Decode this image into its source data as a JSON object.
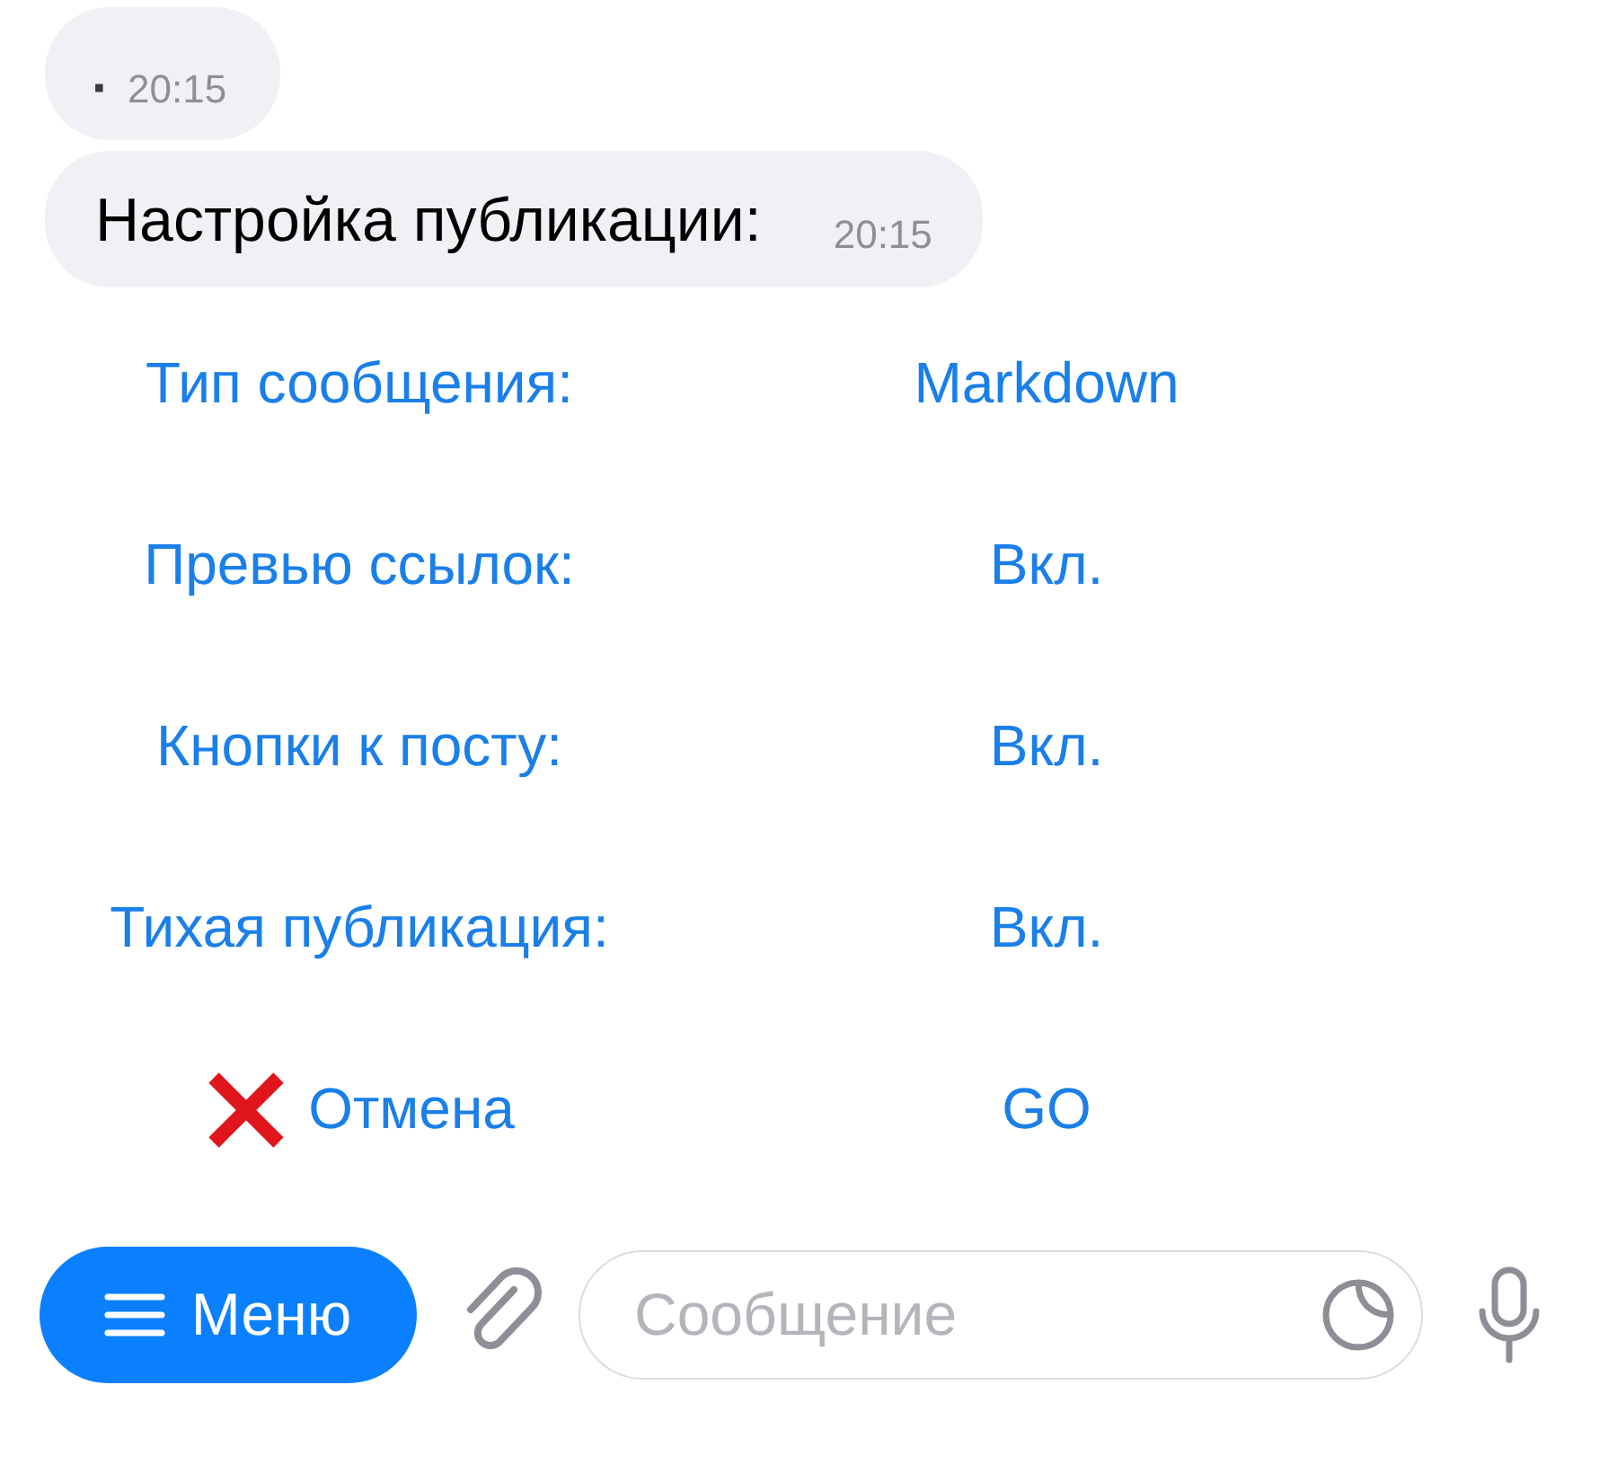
{
  "messages": [
    {
      "kind": "time_only",
      "marker": "·",
      "time": "20:15"
    },
    {
      "kind": "text",
      "text": "Настройка публикации:",
      "time": "20:15"
    }
  ],
  "keyboard": [
    [
      {
        "kind": "plain",
        "label": "Тип сообщения:"
      },
      {
        "kind": "plain",
        "label": "Markdown"
      }
    ],
    [
      {
        "kind": "plain",
        "label": "Превью ссылок:"
      },
      {
        "kind": "plain",
        "label": "Вкл."
      }
    ],
    [
      {
        "kind": "plain",
        "label": "Кнопки к посту:"
      },
      {
        "kind": "plain",
        "label": "Вкл."
      }
    ],
    [
      {
        "kind": "plain",
        "label": "Тихая публикация:"
      },
      {
        "kind": "plain",
        "label": "Вкл."
      }
    ],
    [
      {
        "kind": "cancel",
        "label": "Отмена"
      },
      {
        "kind": "plain",
        "label": "GO"
      }
    ]
  ],
  "composer": {
    "menu_label": "Меню",
    "placeholder": "Сообщение"
  }
}
